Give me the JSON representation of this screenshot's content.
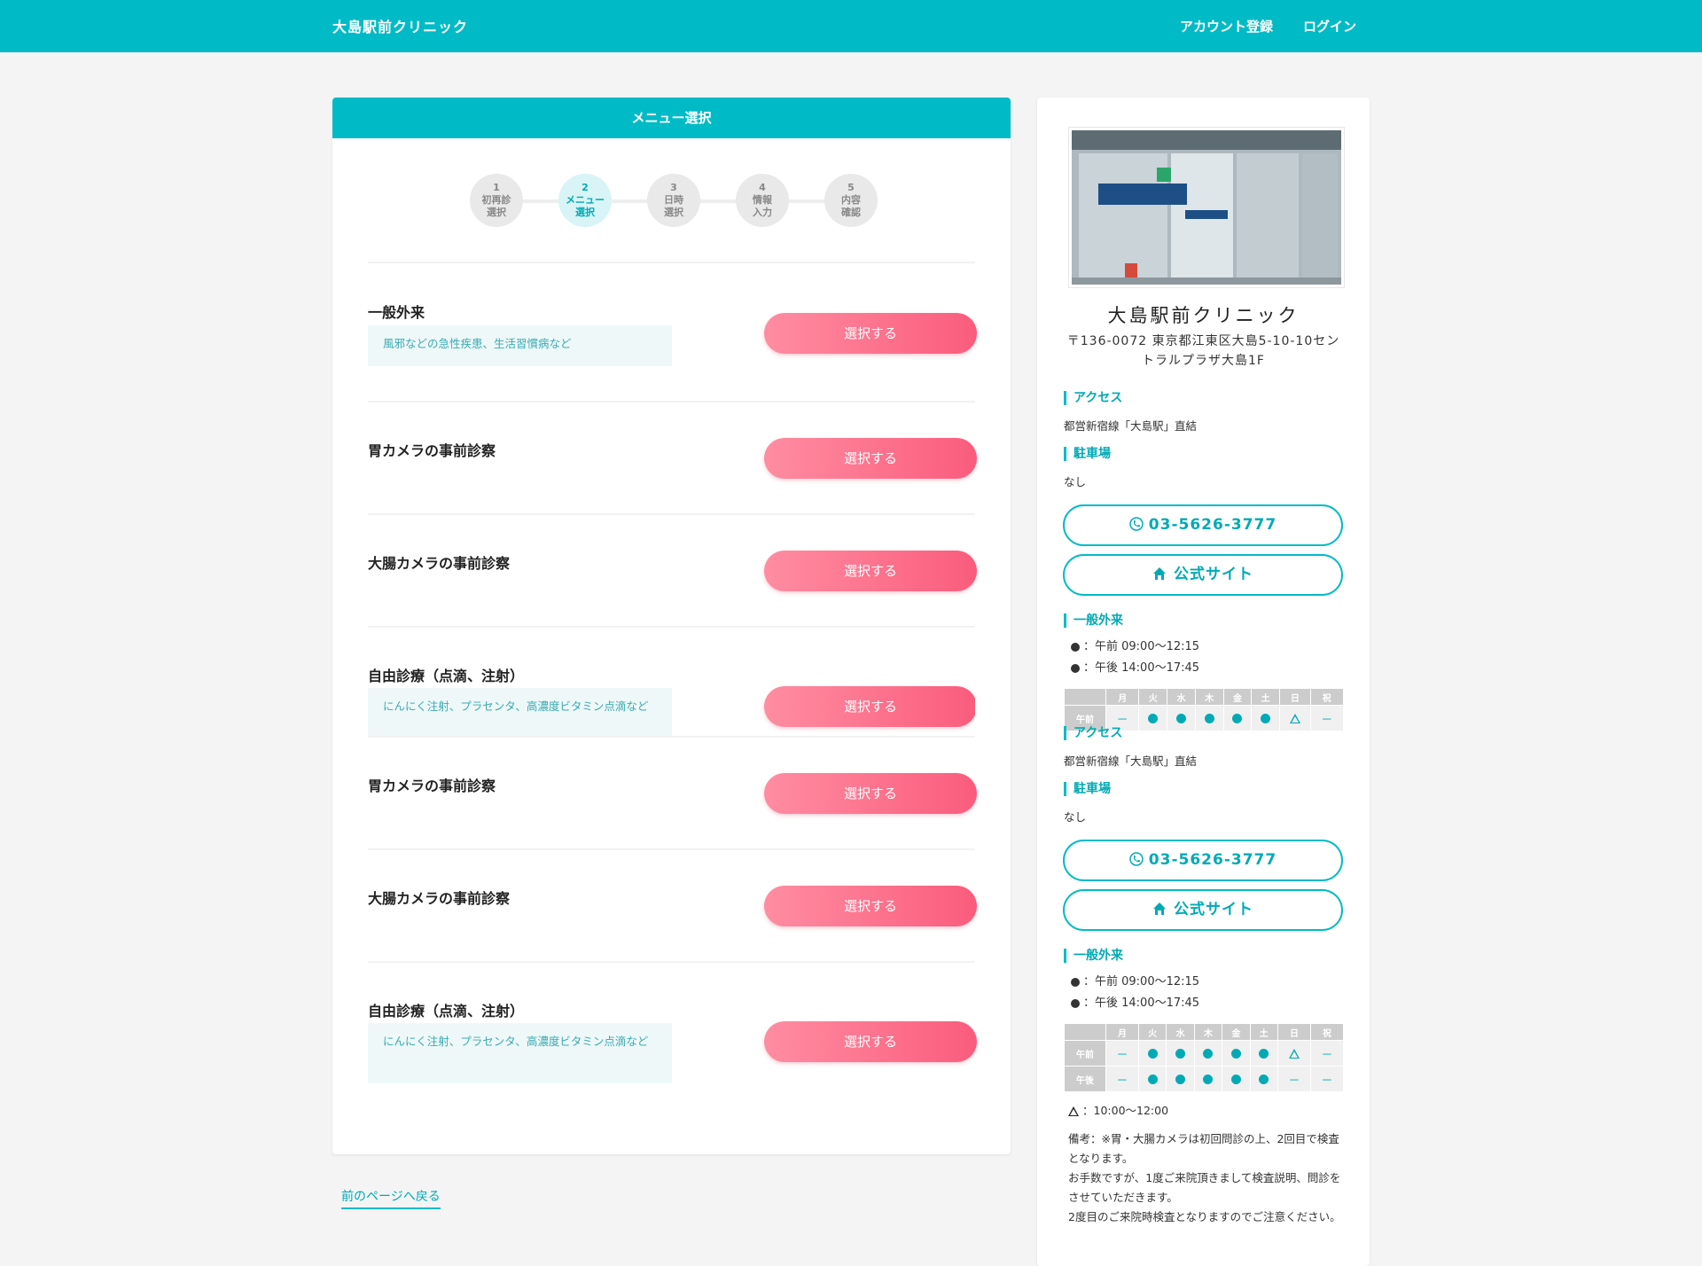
{
  "header": {
    "logo": "大島駅前クリニック",
    "register": "アカウント登録",
    "login": "ログイン"
  },
  "card": {
    "title": "メニュー選択"
  },
  "steps": [
    {
      "num": "1",
      "l1": "初再診",
      "l2": "選択"
    },
    {
      "num": "2",
      "l1": "メニュー",
      "l2": "選択"
    },
    {
      "num": "3",
      "l1": "日時",
      "l2": "選択"
    },
    {
      "num": "4",
      "l1": "情報",
      "l2": "入力"
    },
    {
      "num": "5",
      "l1": "内容",
      "l2": "確認"
    }
  ],
  "current_step": 2,
  "menu": [
    {
      "name": "一般外来",
      "desc": "風邪などの急性疾患、生活習慣病など",
      "button": "選択する"
    },
    {
      "name": "胃カメラの事前診察",
      "button": "選択する"
    },
    {
      "name": "大腸カメラの事前診察",
      "button": "選択する"
    },
    {
      "name": "自由診療（点滴、注射）",
      "desc": "にんにく注射、プラセンタ、高濃度ビタミン点滴など",
      "button": "選択する"
    },
    {
      "name": "胃カメラの事前診察",
      "button": "選択する"
    },
    {
      "name": "大腸カメラの事前診察",
      "button": "選択する"
    },
    {
      "name": "自由診療（点滴、注射）",
      "desc": "にんにく注射、プラセンタ、高濃度ビタミン点滴など",
      "button": "選択する"
    }
  ],
  "back_link": "前のページへ戻る",
  "clinic": {
    "name": "大島駅前クリニック",
    "address": "〒136-0072 東京都江東区大島5-10-10セントラルプラザ大島1F",
    "access_label": "アクセス",
    "access": "都営新宿線「大島駅」直結",
    "parking_label": "駐車場",
    "parking": "なし",
    "phone": "03-5626-3777",
    "site": "公式サイト",
    "outpatient_label": "一般外来",
    "am_hours": "：午前  09:00～12:15",
    "pm_hours": "：午後  14:00～17:45",
    "days": [
      "月",
      "火",
      "水",
      "木",
      "金",
      "土",
      "日",
      "祝"
    ],
    "am_label": "午前",
    "pm_label": "午後",
    "am_schedule": [
      "dash",
      "dot",
      "dot",
      "dot",
      "dot",
      "dot",
      "tri",
      "dash"
    ],
    "pm_schedule": [
      "dash",
      "dot",
      "dot",
      "dot",
      "dot",
      "dot",
      "dash",
      "dash"
    ],
    "dash_symbol": "－",
    "tri_note": "：10:00～12:00",
    "remarks": [
      "備考：※胃・大腸カメラは初回問診の上、2回目で検査となります。",
      "お手数ですが、1度ご来院頂きまして検査説明、問診をさせていただきます。",
      "2度目のご来院時検査となりますのでご注意ください。"
    ]
  },
  "colors": {
    "primary": "#00bbc6",
    "button_start": "#ff8da2",
    "button_end": "#fa5c7c"
  }
}
